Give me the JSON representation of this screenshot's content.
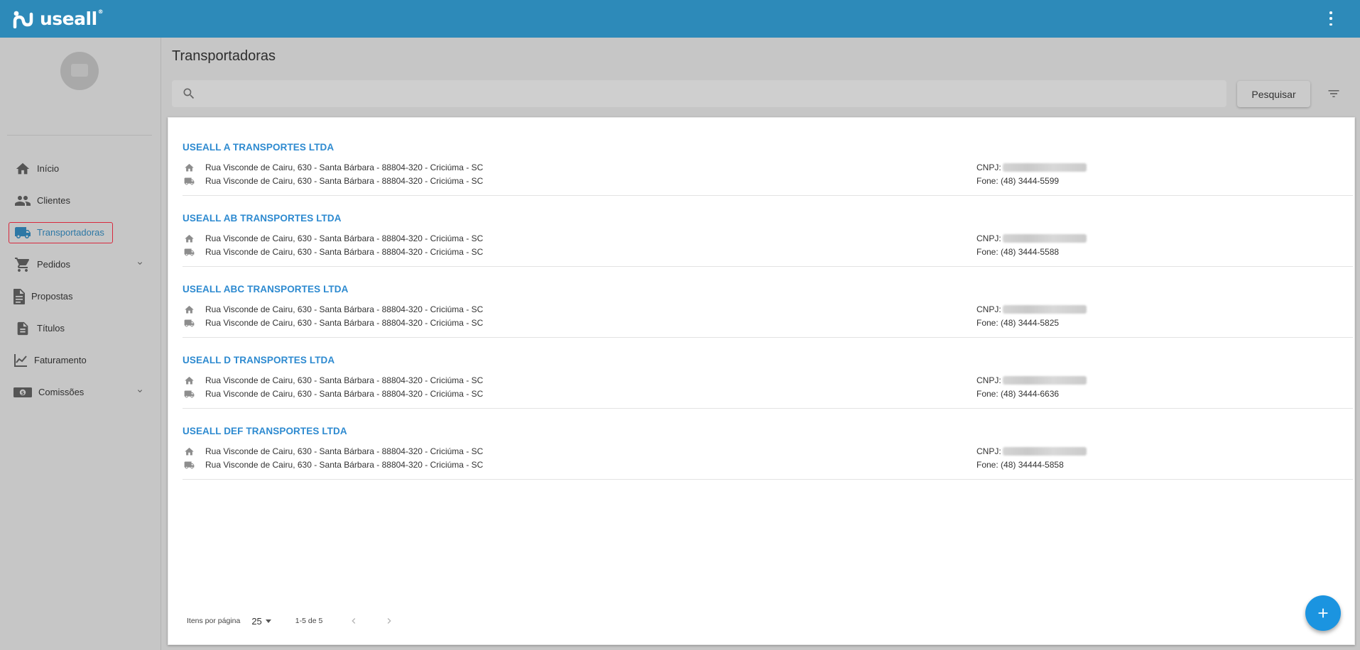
{
  "app": {
    "logo_text": "useall",
    "logo_reg": "®",
    "menu_icon": "more-vert-icon",
    "colors": {
      "topbar": "#2d8ab9",
      "accent": "#2d8ad0",
      "fab": "#1b94e0",
      "active_outline": "#d8283d"
    }
  },
  "sidebar": {
    "items": [
      {
        "label": "Início",
        "icon": "home-icon"
      },
      {
        "label": "Clientes",
        "icon": "people-icon"
      },
      {
        "label": "Transportadoras",
        "icon": "truck-icon",
        "active": true
      },
      {
        "label": "Pedidos",
        "icon": "cart-icon",
        "expandable": true
      },
      {
        "label": "Propostas",
        "icon": "document-icon"
      },
      {
        "label": "Títulos",
        "icon": "description-icon"
      },
      {
        "label": "Faturamento",
        "icon": "chart-icon"
      },
      {
        "label": "Comissões",
        "icon": "money-icon",
        "expandable": true
      }
    ]
  },
  "page": {
    "title": "Transportadoras",
    "search": {
      "value": "",
      "placeholder": ""
    },
    "search_button": "Pesquisar"
  },
  "carriers": [
    {
      "name": "USEALL A TRANSPORTES LTDA",
      "address": "Rua Visconde de Cairu, 630 - Santa Bárbara - 88804-320 - Criciúma - SC",
      "delivery_address": "Rua Visconde de Cairu, 630 - Santa Bárbara - 88804-320 - Criciúma - SC",
      "cnpj_label": "CNPJ:",
      "phone": "Fone: (48) 3444-5599"
    },
    {
      "name": "USEALL AB TRANSPORTES LTDA",
      "address": "Rua Visconde de Cairu, 630 - Santa Bárbara - 88804-320 - Criciúma - SC",
      "delivery_address": "Rua Visconde de Cairu, 630 - Santa Bárbara - 88804-320 - Criciúma - SC",
      "cnpj_label": "CNPJ:",
      "phone": "Fone: (48) 3444-5588"
    },
    {
      "name": "USEALL ABC TRANSPORTES LTDA",
      "address": "Rua Visconde de Cairu, 630 - Santa Bárbara - 88804-320 - Criciúma - SC",
      "delivery_address": "Rua Visconde de Cairu, 630 - Santa Bárbara - 88804-320 - Criciúma - SC",
      "cnpj_label": "CNPJ:",
      "phone": "Fone: (48) 3444-5825"
    },
    {
      "name": "USEALL D TRANSPORTES LTDA",
      "address": "Rua Visconde de Cairu, 630 - Santa Bárbara - 88804-320 - Criciúma - SC",
      "delivery_address": "Rua Visconde de Cairu, 630 - Santa Bárbara - 88804-320 - Criciúma - SC",
      "cnpj_label": "CNPJ:",
      "phone": "Fone: (48) 3444-6636"
    },
    {
      "name": "USEALL DEF TRANSPORTES LTDA",
      "address": "Rua Visconde de Cairu, 630 - Santa Bárbara - 88804-320 - Criciúma - SC",
      "delivery_address": "Rua Visconde de Cairu, 630 - Santa Bárbara - 88804-320 - Criciúma - SC",
      "cnpj_label": "CNPJ:",
      "phone": "Fone: (48) 34444-5858"
    }
  ],
  "paginator": {
    "items_per_page_label": "Itens por página",
    "page_size": "25",
    "range": "1-5 de 5"
  },
  "fab": {
    "label": "+",
    "icon": "add-icon"
  }
}
